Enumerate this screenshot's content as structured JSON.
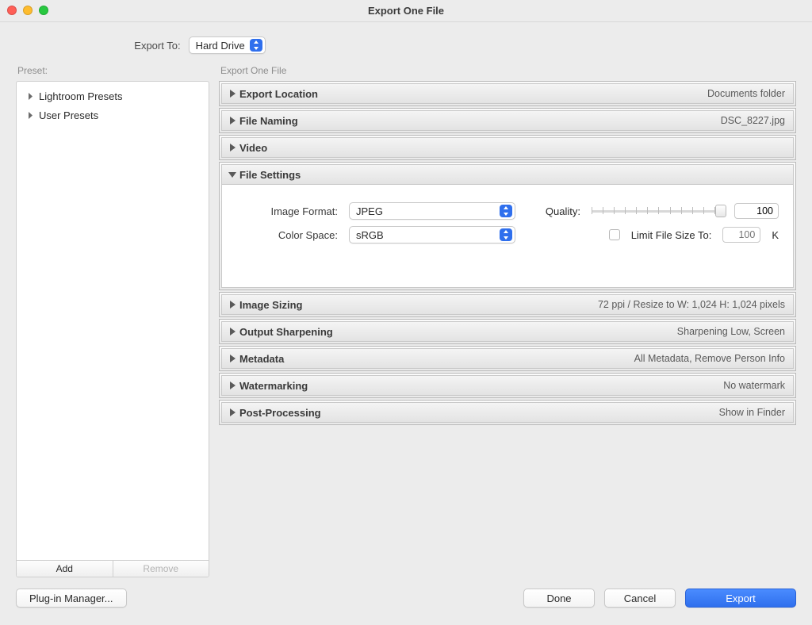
{
  "window": {
    "title": "Export One File"
  },
  "exportTo": {
    "label": "Export To:",
    "value": "Hard Drive"
  },
  "preset": {
    "label": "Preset:",
    "items": [
      "Lightroom Presets",
      "User Presets"
    ],
    "buttons": {
      "add": "Add",
      "remove": "Remove"
    }
  },
  "right": {
    "heading": "Export One File",
    "panels": {
      "exportLocation": {
        "title": "Export Location",
        "summary": "Documents folder"
      },
      "fileNaming": {
        "title": "File Naming",
        "summary": "DSC_8227.jpg"
      },
      "video": {
        "title": "Video",
        "summary": ""
      },
      "fileSettings": {
        "title": "File Settings",
        "imageFormat": {
          "label": "Image Format:",
          "value": "JPEG"
        },
        "quality": {
          "label": "Quality:",
          "value": "100"
        },
        "colorSpace": {
          "label": "Color Space:",
          "value": "sRGB"
        },
        "limitSize": {
          "label": "Limit File Size To:",
          "value": "100",
          "unit": "K",
          "checked": false
        }
      },
      "imageSizing": {
        "title": "Image Sizing",
        "summary": "72 ppi / Resize to W: 1,024 H: 1,024 pixels"
      },
      "sharpening": {
        "title": "Output Sharpening",
        "summary": "Sharpening Low, Screen"
      },
      "metadata": {
        "title": "Metadata",
        "summary": "All Metadata, Remove Person Info"
      },
      "watermarking": {
        "title": "Watermarking",
        "summary": "No watermark"
      },
      "postProcessing": {
        "title": "Post-Processing",
        "summary": "Show in Finder"
      }
    }
  },
  "footer": {
    "pluginManager": "Plug-in Manager...",
    "done": "Done",
    "cancel": "Cancel",
    "export": "Export"
  }
}
